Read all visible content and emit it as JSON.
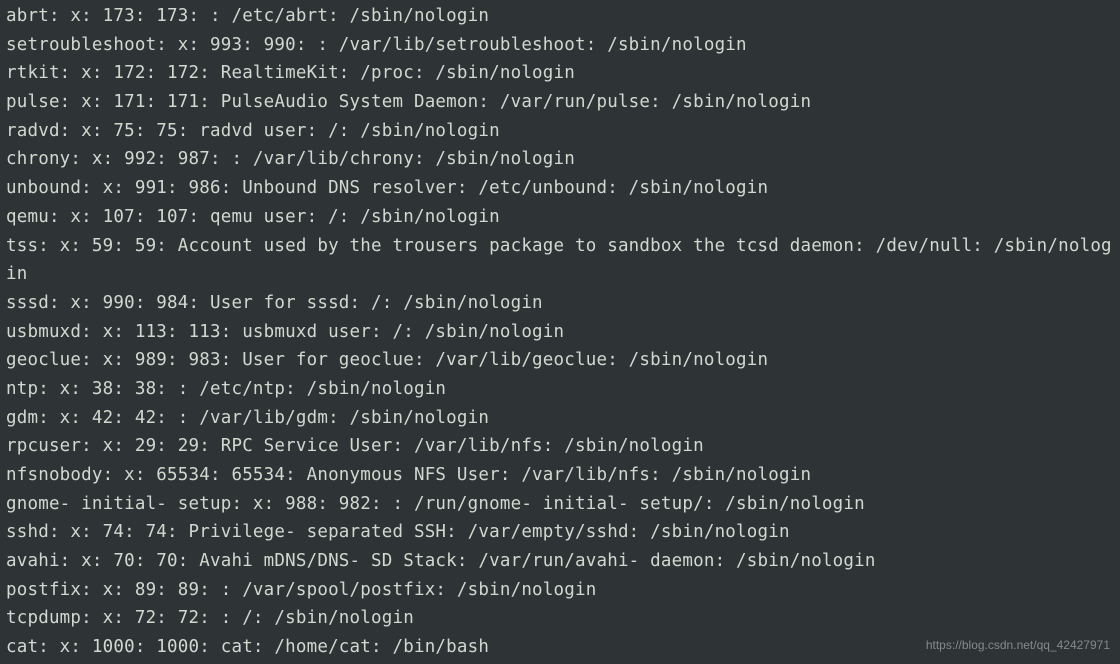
{
  "terminal": {
    "lines": [
      "abrt: x: 173: 173: : /etc/abrt: /sbin/nologin",
      "setroubleshoot: x: 993: 990: : /var/lib/setroubleshoot: /sbin/nologin",
      "rtkit: x: 172: 172: RealtimeKit: /proc: /sbin/nologin",
      "pulse: x: 171: 171: PulseAudio System Daemon: /var/run/pulse: /sbin/nologin",
      "radvd: x: 75: 75: radvd user: /: /sbin/nologin",
      "chrony: x: 992: 987: : /var/lib/chrony: /sbin/nologin",
      "unbound: x: 991: 986: Unbound DNS resolver: /etc/unbound: /sbin/nologin",
      "qemu: x: 107: 107: qemu user: /: /sbin/nologin",
      "tss: x: 59: 59: Account used by the trousers package to sandbox the tcsd daemon: /dev/null: /sbin/nologin",
      "sssd: x: 990: 984: User for sssd: /: /sbin/nologin",
      "usbmuxd: x: 113: 113: usbmuxd user: /: /sbin/nologin",
      "geoclue: x: 989: 983: User for geoclue: /var/lib/geoclue: /sbin/nologin",
      "ntp: x: 38: 38: : /etc/ntp: /sbin/nologin",
      "gdm: x: 42: 42: : /var/lib/gdm: /sbin/nologin",
      "rpcuser: x: 29: 29: RPC Service User: /var/lib/nfs: /sbin/nologin",
      "nfsnobody: x: 65534: 65534: Anonymous NFS User: /var/lib/nfs: /sbin/nologin",
      "gnome- initial- setup: x: 988: 982: : /run/gnome- initial- setup/: /sbin/nologin",
      "sshd: x: 74: 74: Privilege- separated SSH: /var/empty/sshd: /sbin/nologin",
      "avahi: x: 70: 70: Avahi mDNS/DNS- SD Stack: /var/run/avahi- daemon: /sbin/nologin",
      "postfix: x: 89: 89: : /var/spool/postfix: /sbin/nologin",
      "tcpdump: x: 72: 72: : /: /sbin/nologin",
      "cat: x: 1000: 1000: cat: /home/cat: /bin/bash"
    ]
  },
  "watermark": "https://blog.csdn.net/qq_42427971"
}
